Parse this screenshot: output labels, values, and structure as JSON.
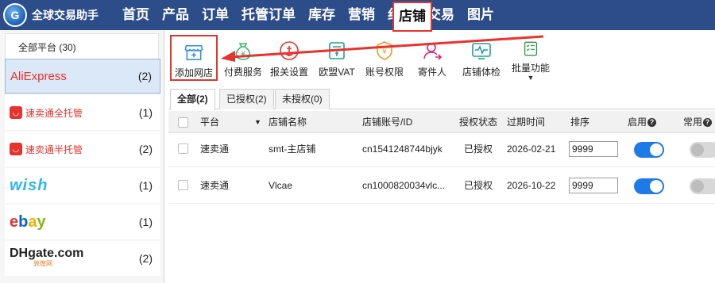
{
  "app": {
    "title": "全球交易助手",
    "logo_letter": "G"
  },
  "nav": {
    "items": [
      "首页",
      "产品",
      "订单",
      "托管订单",
      "库存",
      "营销",
      "纠纷",
      "交易",
      "图片"
    ],
    "active": "店铺"
  },
  "sidebar": {
    "header": "全部平台 (30)",
    "platforms": [
      {
        "name": "AliExpress",
        "count": "(2)"
      },
      {
        "name": "速卖通全托管",
        "count": "(1)"
      },
      {
        "name": "速卖通半托管",
        "count": "(2)"
      },
      {
        "name": "wish",
        "count": "(1)"
      },
      {
        "name": "ebay",
        "count": "(1)"
      },
      {
        "name": "DHgate.com",
        "sub": "敦煌网",
        "count": "(2)"
      }
    ]
  },
  "toolbar": {
    "add_store": "添加网店",
    "paid_service": "付费服务",
    "customs": "报关设置",
    "eu_vat": "欧盟VAT",
    "account_perm": "账号权限",
    "sender": "寄件人",
    "store_check": "店铺体检",
    "batch": "批量功能"
  },
  "tabs": [
    {
      "label": "全部(2)"
    },
    {
      "label": "已授权(2)"
    },
    {
      "label": "未授权(0)"
    }
  ],
  "table": {
    "headers": {
      "platform": "平台",
      "store_name": "店铺名称",
      "account": "店铺账号/ID",
      "auth_status": "授权状态",
      "expire": "过期时间",
      "sort": "排序",
      "enabled": "启用",
      "common": "常用"
    },
    "rows": [
      {
        "platform": "速卖通",
        "store_name": "smt-主店铺",
        "account": "cn1541248744bjyk",
        "auth_status": "已授权",
        "expire": "2026-02-21",
        "sort": "9999",
        "enabled": true,
        "common": false
      },
      {
        "platform": "速卖通",
        "store_name": "Vlcae",
        "account": "cn1000820034vlc...",
        "auth_status": "已授权",
        "expire": "2026-10-22",
        "sort": "9999",
        "enabled": true,
        "common": false
      }
    ]
  },
  "colors": {
    "nav_bg": "#2d4d8a",
    "accent": "#1e7ae6",
    "highlight": "#e8322d"
  }
}
